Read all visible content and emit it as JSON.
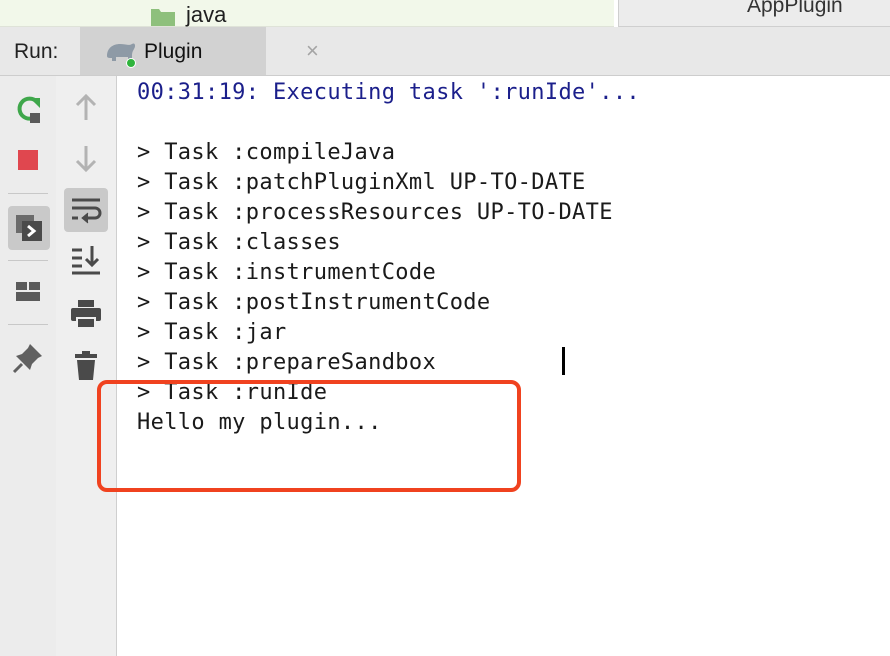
{
  "project_tree": {
    "folder_label": "java"
  },
  "editor_tab": {
    "label": "AppPlugin"
  },
  "run_panel": {
    "label": "Run:",
    "tab": {
      "label": "Plugin",
      "close_glyph": "×",
      "icon": "gradle-elephant-icon"
    }
  },
  "toolbar_left": [
    {
      "name": "rerun-icon",
      "color": "#3fa74b"
    },
    {
      "name": "stop-icon",
      "color": "#e0474f"
    },
    {
      "name": "restore-layout-icon"
    },
    {
      "name": "layout-icon"
    },
    {
      "name": "pin-icon"
    }
  ],
  "toolbar_second": [
    {
      "name": "up-arrow-icon"
    },
    {
      "name": "down-arrow-icon"
    },
    {
      "name": "soft-wrap-icon"
    },
    {
      "name": "scroll-to-end-icon"
    },
    {
      "name": "print-icon"
    },
    {
      "name": "trash-icon"
    }
  ],
  "console": {
    "lines": [
      {
        "text": "00:31:19: Executing task ':runIde'...",
        "kind": "system"
      },
      {
        "text": "",
        "kind": "normal"
      },
      {
        "text": "> Task :compileJava",
        "kind": "normal"
      },
      {
        "text": "> Task :patchPluginXml UP-TO-DATE",
        "kind": "normal"
      },
      {
        "text": "> Task :processResources UP-TO-DATE",
        "kind": "normal"
      },
      {
        "text": "> Task :classes",
        "kind": "normal"
      },
      {
        "text": "> Task :instrumentCode",
        "kind": "normal"
      },
      {
        "text": "> Task :postInstrumentCode",
        "kind": "normal"
      },
      {
        "text": "> Task :jar",
        "kind": "normal"
      },
      {
        "text": "> Task :prepareSandbox",
        "kind": "normal"
      },
      {
        "text": "> Task :runIde",
        "kind": "normal"
      },
      {
        "text": "Hello my plugin...",
        "kind": "normal"
      }
    ]
  },
  "colors": {
    "system_text": "#1b1f8b",
    "highlight_border": "#f0421f",
    "tree_background": "#f2f8ea"
  }
}
